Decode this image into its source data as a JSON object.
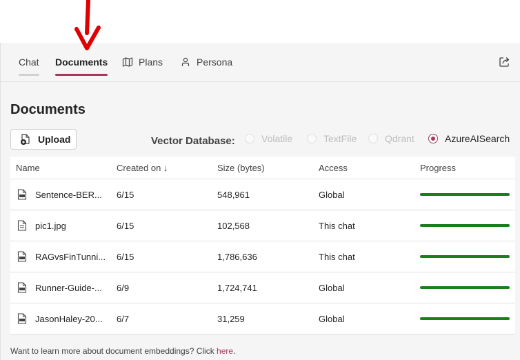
{
  "tabs": [
    {
      "label": "Chat",
      "icon": "none"
    },
    {
      "label": "Documents",
      "icon": "none",
      "active": true
    },
    {
      "label": "Plans",
      "icon": "map-icon"
    },
    {
      "label": "Persona",
      "icon": "person-icon"
    }
  ],
  "page": {
    "title": "Documents",
    "upload_label": "Upload",
    "vector_db_label": "Vector Database:",
    "vector_db_options": [
      "Volatile",
      "TextFile",
      "Qdrant",
      "AzureAISearch"
    ],
    "vector_db_selected": "AzureAISearch"
  },
  "table": {
    "headers": {
      "name": "Name",
      "created": "Created on ↓",
      "size": "Size (bytes)",
      "access": "Access",
      "progress": "Progress"
    },
    "rows": [
      {
        "name": "Sentence-BER...",
        "created": "6/15",
        "size": "548,961",
        "access": "Global",
        "progress": 1.0
      },
      {
        "name": "pic1.jpg",
        "created": "6/15",
        "size": "102,568",
        "access": "This chat",
        "progress": 1.0
      },
      {
        "name": "RAGvsFinTunni...",
        "created": "6/15",
        "size": "1,786,636",
        "access": "This chat",
        "progress": 1.0
      },
      {
        "name": "Runner-Guide-...",
        "created": "6/9",
        "size": "1,724,741",
        "access": "Global",
        "progress": 1.0
      },
      {
        "name": "JasonHaley-20...",
        "created": "6/7",
        "size": "31,259",
        "access": "Global",
        "progress": 1.0
      }
    ]
  },
  "footer": {
    "text": "Want to learn more about document embeddings? Click ",
    "link": "here",
    "end": "."
  },
  "colors": {
    "accent": "#a33a5b",
    "progress": "#1a7f1a",
    "annotation_arrow": "#e00000"
  }
}
